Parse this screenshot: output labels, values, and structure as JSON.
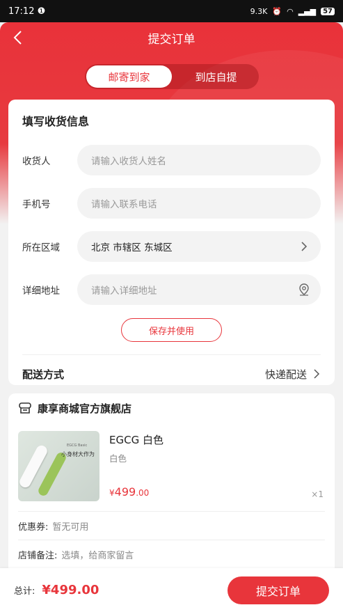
{
  "status": {
    "time": "17:12",
    "notif": "❶",
    "speed": "9.3K",
    "battery": "57"
  },
  "header": {
    "title": "提交订单"
  },
  "tabs": [
    {
      "label": "邮寄到家",
      "active": true
    },
    {
      "label": "到店自提",
      "active": false
    }
  ],
  "address_form": {
    "title": "填写收货信息",
    "fields": [
      {
        "label": "收货人",
        "placeholder": "请输入收货人姓名"
      },
      {
        "label": "手机号",
        "placeholder": "请输入联系电话"
      },
      {
        "label": "所在区域",
        "value": "北京 市辖区 东城区"
      },
      {
        "label": "详细地址",
        "placeholder": "请输入详细地址"
      }
    ],
    "save_label": "保存并使用"
  },
  "shipping": {
    "label": "配送方式",
    "value": "快递配送"
  },
  "shop": {
    "name": "康享商城官方旗舰店",
    "product": {
      "name": "EGCG 白色",
      "spec": "白色",
      "price_symbol": "¥",
      "price_int": "499",
      "price_dec": ".00",
      "qty": "×1",
      "thumb_brand": "EGCG Basic",
      "thumb_slogan": "小身材大作为"
    },
    "coupon": {
      "label": "优惠券:",
      "value": "暂无可用"
    },
    "remark": {
      "label": "店铺备注:",
      "value": "选填，给商家留言"
    }
  },
  "footer": {
    "total_label": "总计:",
    "total_value": "¥499.00",
    "submit_label": "提交订单"
  },
  "colors": {
    "accent": "#e8353b"
  }
}
